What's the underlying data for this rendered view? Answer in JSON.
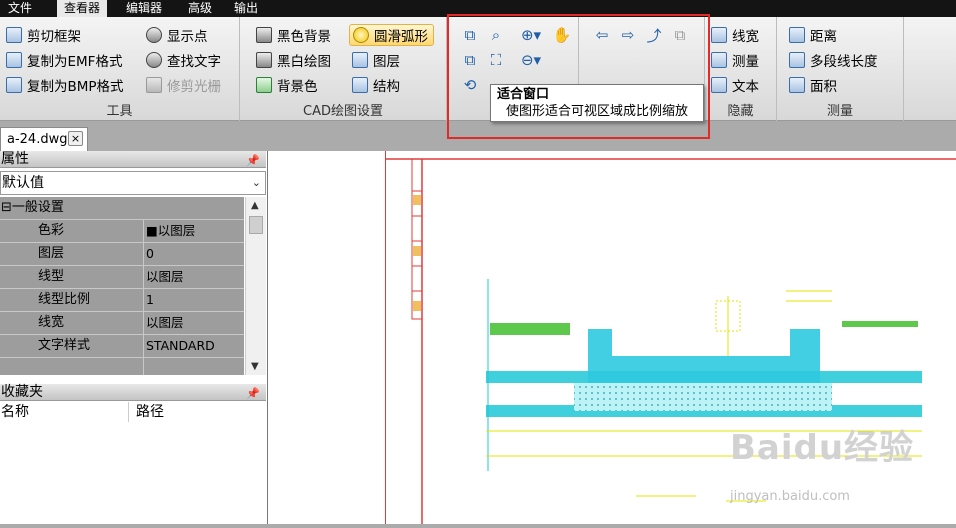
{
  "menu": {
    "tabs": [
      "文件",
      "查看器",
      "编辑器",
      "高级",
      "输出"
    ]
  },
  "ribbon": {
    "tools": {
      "label": "工具",
      "items": [
        "剪切框架",
        "复制为EMF格式",
        "复制为BMP格式",
        "显示点",
        "查找文字",
        "修剪光栅"
      ]
    },
    "cad": {
      "label": "CAD绘图设置",
      "items": [
        "黑色背景",
        "黑白绘图",
        "背景色",
        "圆滑弧形",
        "图层",
        "结构"
      ]
    },
    "hidden": {
      "label": "隐藏",
      "items": [
        "线宽",
        "测量",
        "文本"
      ]
    },
    "measure": {
      "label": "测量",
      "items": [
        "距离",
        "多段线长度",
        "面积"
      ]
    }
  },
  "tooltip": {
    "title": "适合窗口",
    "desc": "使图形适合可视区域成比例缩放"
  },
  "doc_tab": {
    "name": "a-24.dwg",
    "close": "×"
  },
  "properties": {
    "title": "属性",
    "combo": "默认值",
    "section": "⊟一般设置",
    "rows": [
      {
        "name": "色彩",
        "value": "■以图层"
      },
      {
        "name": "图层",
        "value": "0"
      },
      {
        "name": "线型",
        "value": "以图层"
      },
      {
        "name": "线型比例",
        "value": "1"
      },
      {
        "name": "线宽",
        "value": "以图层"
      },
      {
        "name": "文字样式",
        "value": "STANDARD"
      }
    ]
  },
  "favorites": {
    "title": "收藏夹",
    "col_name": "名称",
    "col_path": "路径"
  },
  "watermark": {
    "brand": "Baidu经验",
    "url": "jingyan.baidu.com"
  },
  "colors": {
    "highlight_box": "#e12a2a",
    "cad_cyan": "#1fc7d6",
    "cad_yellow": "#e4e400",
    "cad_green": "#4cc23a"
  }
}
